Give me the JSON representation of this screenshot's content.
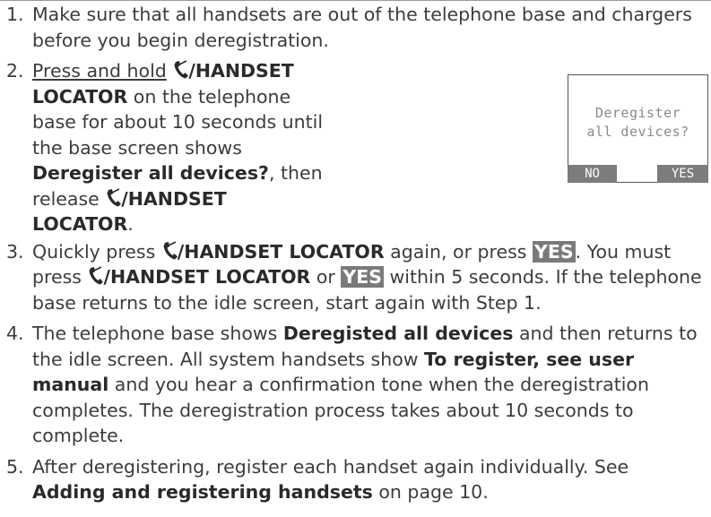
{
  "steps": [
    {
      "number": "1.",
      "text": "Make sure that all handsets are out of the telephone base and chargers before you begin deregistration."
    },
    {
      "number": "2.",
      "press_hold": "Press and hold",
      "key": "/HANDSET LOCATOR",
      "text_a": " on the telephone base for about 10 seconds until the base screen shows ",
      "screen_msg": "Deregister all devices?",
      "text_b": ", then release ",
      "text_c": "."
    },
    {
      "number": "3.",
      "text_a": "Quickly press ",
      "key": "/HANDSET LOCATOR",
      "text_b": " again, or press ",
      "yes": "YES",
      "text_c": ". You must press ",
      "text_d": " or ",
      "text_e": " within 5 seconds. If the telephone base returns to the idle screen, start again with Step 1."
    },
    {
      "number": "4.",
      "text_a": "The telephone base shows ",
      "msg1": "Deregisted all devices",
      "text_b": " and then returns to the idle screen. All system handsets show ",
      "msg2": "To register, see user manual",
      "text_c": " and you hear a confirmation tone when the deregistration completes. The deregistration process takes about 10 seconds to complete."
    },
    {
      "number": "5.",
      "text_a": "After deregistering, register each handset again individually. See ",
      "link": "Adding and registering handsets",
      "text_b": " on page 10."
    }
  ],
  "lcd": {
    "line1": "Deregister",
    "line2": "all devices?",
    "soft_left": "NO",
    "soft_right": "YES"
  },
  "icons": {
    "handset_key": "phone-handset-icon"
  }
}
